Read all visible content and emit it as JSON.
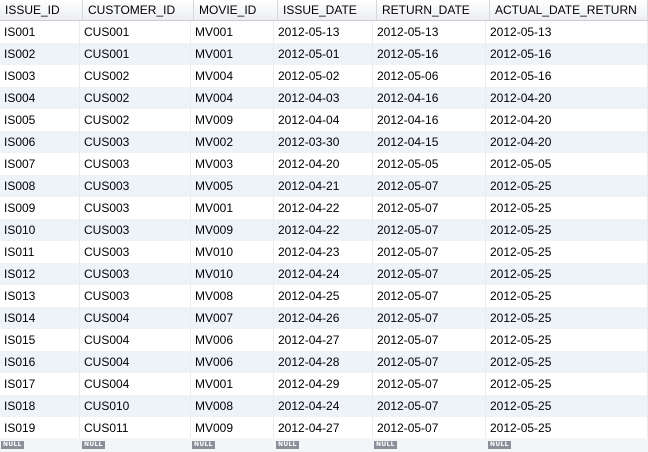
{
  "table": {
    "columns": [
      "ISSUE_ID",
      "CUSTOMER_ID",
      "MOVIE_ID",
      "ISSUE_DATE",
      "RETURN_DATE",
      "ACTUAL_DATE_RETURN"
    ],
    "rows": [
      [
        "IS001",
        "CUS001",
        "MV001",
        "2012-05-13",
        "2012-05-13",
        "2012-05-13"
      ],
      [
        "IS002",
        "CUS001",
        "MV001",
        "2012-05-01",
        "2012-05-16",
        "2012-05-16"
      ],
      [
        "IS003",
        "CUS002",
        "MV004",
        "2012-05-02",
        "2012-05-06",
        "2012-05-16"
      ],
      [
        "IS004",
        "CUS002",
        "MV004",
        "2012-04-03",
        "2012-04-16",
        "2012-04-20"
      ],
      [
        "IS005",
        "CUS002",
        "MV009",
        "2012-04-04",
        "2012-04-16",
        "2012-04-20"
      ],
      [
        "IS006",
        "CUS003",
        "MV002",
        "2012-03-30",
        "2012-04-15",
        "2012-04-20"
      ],
      [
        "IS007",
        "CUS003",
        "MV003",
        "2012-04-20",
        "2012-05-05",
        "2012-05-05"
      ],
      [
        "IS008",
        "CUS003",
        "MV005",
        "2012-04-21",
        "2012-05-07",
        "2012-05-25"
      ],
      [
        "IS009",
        "CUS003",
        "MV001",
        "2012-04-22",
        "2012-05-07",
        "2012-05-25"
      ],
      [
        "IS010",
        "CUS003",
        "MV009",
        "2012-04-22",
        "2012-05-07",
        "2012-05-25"
      ],
      [
        "IS011",
        "CUS003",
        "MV010",
        "2012-04-23",
        "2012-05-07",
        "2012-05-25"
      ],
      [
        "IS012",
        "CUS003",
        "MV010",
        "2012-04-24",
        "2012-05-07",
        "2012-05-25"
      ],
      [
        "IS013",
        "CUS003",
        "MV008",
        "2012-04-25",
        "2012-05-07",
        "2012-05-25"
      ],
      [
        "IS014",
        "CUS004",
        "MV007",
        "2012-04-26",
        "2012-05-07",
        "2012-05-25"
      ],
      [
        "IS015",
        "CUS004",
        "MV006",
        "2012-04-27",
        "2012-05-07",
        "2012-05-25"
      ],
      [
        "IS016",
        "CUS004",
        "MV006",
        "2012-04-28",
        "2012-05-07",
        "2012-05-25"
      ],
      [
        "IS017",
        "CUS004",
        "MV001",
        "2012-04-29",
        "2012-05-07",
        "2012-05-25"
      ],
      [
        "IS018",
        "CUS010",
        "MV008",
        "2012-04-24",
        "2012-05-07",
        "2012-05-25"
      ],
      [
        "IS019",
        "CUS011",
        "MV009",
        "2012-04-27",
        "2012-05-07",
        "2012-05-25"
      ]
    ],
    "null_label": "NULL"
  },
  "colors": {
    "header_bg": "#eceef2",
    "alt_row_bg": "#eef3fa",
    "null_badge_bg": "#8a8f99"
  }
}
